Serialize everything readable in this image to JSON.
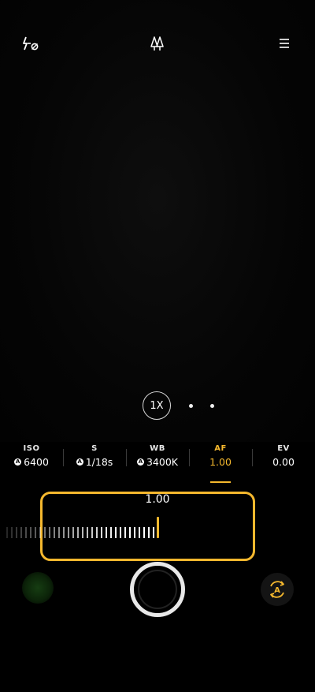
{
  "top_bar": {
    "flash_icon": "flash-off-icon",
    "mode_icon": "trees-mode-icon",
    "menu_icon": "menu-icon"
  },
  "zoom": {
    "label": "1X",
    "dot_count": 2
  },
  "params": [
    {
      "label": "ISO",
      "value": "6400",
      "auto": true,
      "active": false
    },
    {
      "label": "S",
      "value": "1/18s",
      "auto": true,
      "active": false
    },
    {
      "label": "WB",
      "value": "3400K",
      "auto": true,
      "active": false
    },
    {
      "label": "AF",
      "value": "1.00",
      "auto": false,
      "active": true
    },
    {
      "label": "EV",
      "value": "0.00",
      "auto": false,
      "active": false
    }
  ],
  "auto_badge": "A",
  "slider": {
    "value": "1.00"
  },
  "bottom": {
    "auto_toggle_label": "A"
  },
  "colors": {
    "accent": "#f5b82e",
    "background": "#000000"
  }
}
